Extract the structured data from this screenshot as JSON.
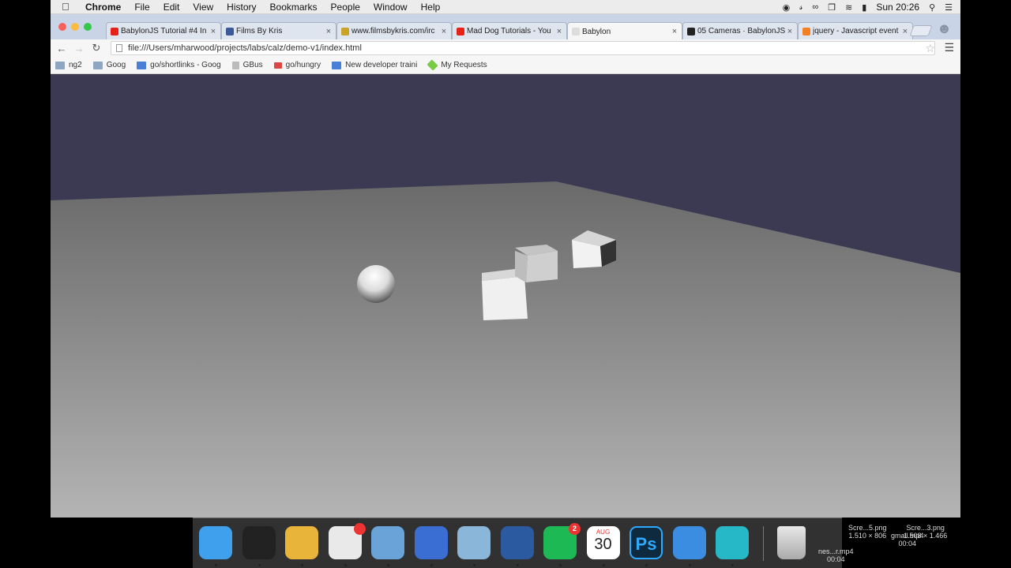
{
  "menubar": {
    "app_name": "Chrome",
    "items": [
      "File",
      "Edit",
      "View",
      "History",
      "Bookmarks",
      "People",
      "Window",
      "Help"
    ],
    "clock": "Sun 20:26"
  },
  "tabs": [
    {
      "title": "BabylonJS Tutorial #4 In",
      "favicon": "youtube-icon",
      "color": "#e62117"
    },
    {
      "title": "Films By Kris",
      "favicon": "facebook-icon",
      "color": "#3b5998"
    },
    {
      "title": "www.filmsbykris.com/irc",
      "favicon": "emoji-icon",
      "color": "#c9a227"
    },
    {
      "title": "Mad Dog Tutorials - You",
      "favicon": "youtube-icon",
      "color": "#e62117"
    },
    {
      "title": "Babylon",
      "favicon": "page-icon",
      "color": "#dddddd"
    },
    {
      "title": "05 Cameras · BabylonJS",
      "favicon": "github-icon",
      "color": "#222222"
    },
    {
      "title": "jquery - Javascript event",
      "favicon": "stackoverflow-icon",
      "color": "#f48024"
    }
  ],
  "active_tab_index": 4,
  "address_bar": {
    "url": "file:///Users/mharwood/projects/labs/calz/demo-v1/index.html"
  },
  "bookmarks": [
    {
      "label": "ng2",
      "icon": "folder-icon"
    },
    {
      "label": "Goog",
      "icon": "folder-icon"
    },
    {
      "label": "go/shortlinks - Goog",
      "icon": "doc-icon"
    },
    {
      "label": "GBus",
      "icon": "bus-icon"
    },
    {
      "label": "go/hungry",
      "icon": "knife-icon"
    },
    {
      "label": "New developer traini",
      "icon": "doc-icon"
    },
    {
      "label": "My Requests",
      "icon": "request-icon"
    }
  ],
  "scene": {
    "sky_color": "#3b3a52",
    "ground_color": "#8a8a8a",
    "objects": [
      "sphere",
      "box",
      "box",
      "box"
    ]
  },
  "dock": {
    "apps": [
      {
        "name": "finder",
        "color": "#3fa0ee"
      },
      {
        "name": "terminal",
        "color": "#222222"
      },
      {
        "name": "chrome",
        "color": "#e8b53a"
      },
      {
        "name": "slack",
        "color": "#e9e9e9",
        "badge": ""
      },
      {
        "name": "preview-eagle",
        "color": "#6aa3d8"
      },
      {
        "name": "vm-fusion",
        "color": "#3a6ed3"
      },
      {
        "name": "iphoto",
        "color": "#89b6d9"
      },
      {
        "name": "quicktime",
        "color": "#2c5aa0"
      },
      {
        "name": "spotify",
        "color": "#1db954",
        "badge": "2"
      },
      {
        "name": "calendar",
        "color": "#ffffff",
        "month": "AUG",
        "day": "30"
      },
      {
        "name": "photoshop",
        "color": "#0d2a3e",
        "label": "Ps"
      },
      {
        "name": "safari",
        "color": "#3a8de0"
      },
      {
        "name": "webstorm",
        "color": "#27b8c8"
      }
    ],
    "trash": "trash-icon"
  },
  "desktop_files": [
    {
      "name": "Scre...5.png",
      "size": "1.510 × 806"
    },
    {
      "name": "Scre...3.png",
      "size": "1.508 × 1.466"
    },
    {
      "name": "gmail.mp4",
      "duration": "00:04"
    },
    {
      "name": "nes...r.mp4",
      "duration": "00:04"
    }
  ]
}
